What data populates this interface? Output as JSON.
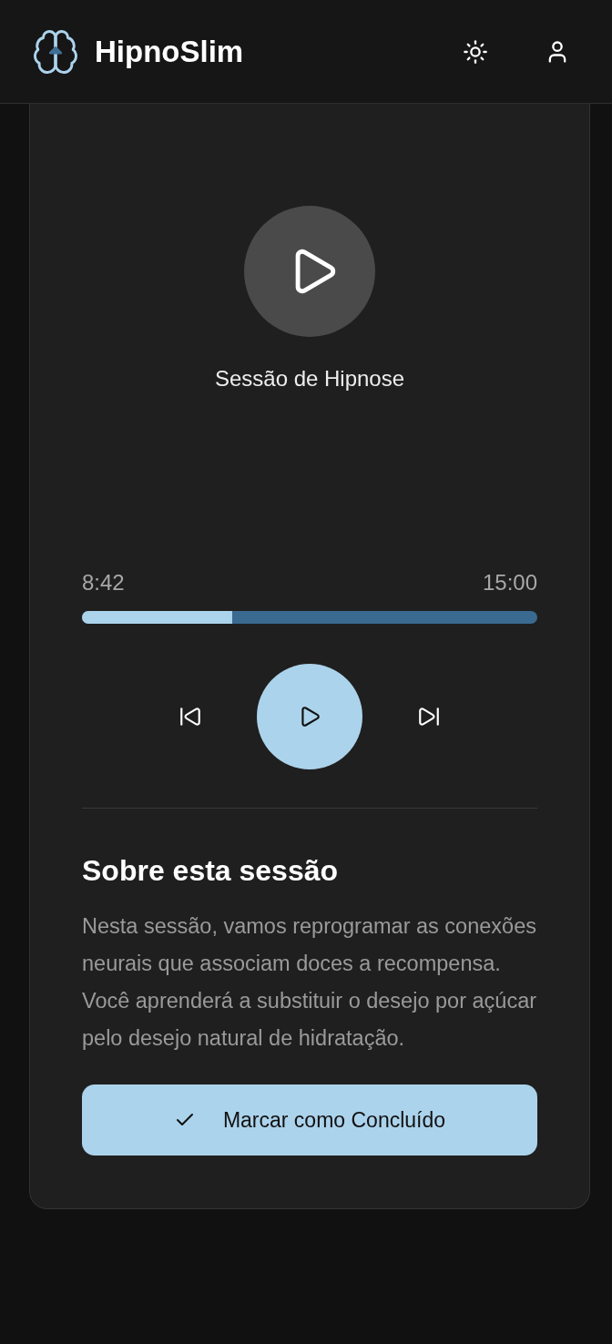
{
  "header": {
    "title": "HipnoSlim"
  },
  "player": {
    "title": "Sessão de Hipnose",
    "elapsed": "8:42",
    "duration": "15:00",
    "level": 0.33,
    "playing": false
  },
  "about": {
    "heading": "Sobre esta sessão",
    "text": "Nesta sessão, vamos reprogramar as conexões neurais que associam doces a recompensa. Você aprenderá a substituir o desejo por açúcar pelo desejo natural de hidratação."
  },
  "complete_button": {
    "label": "Marcar como Concluído"
  }
}
